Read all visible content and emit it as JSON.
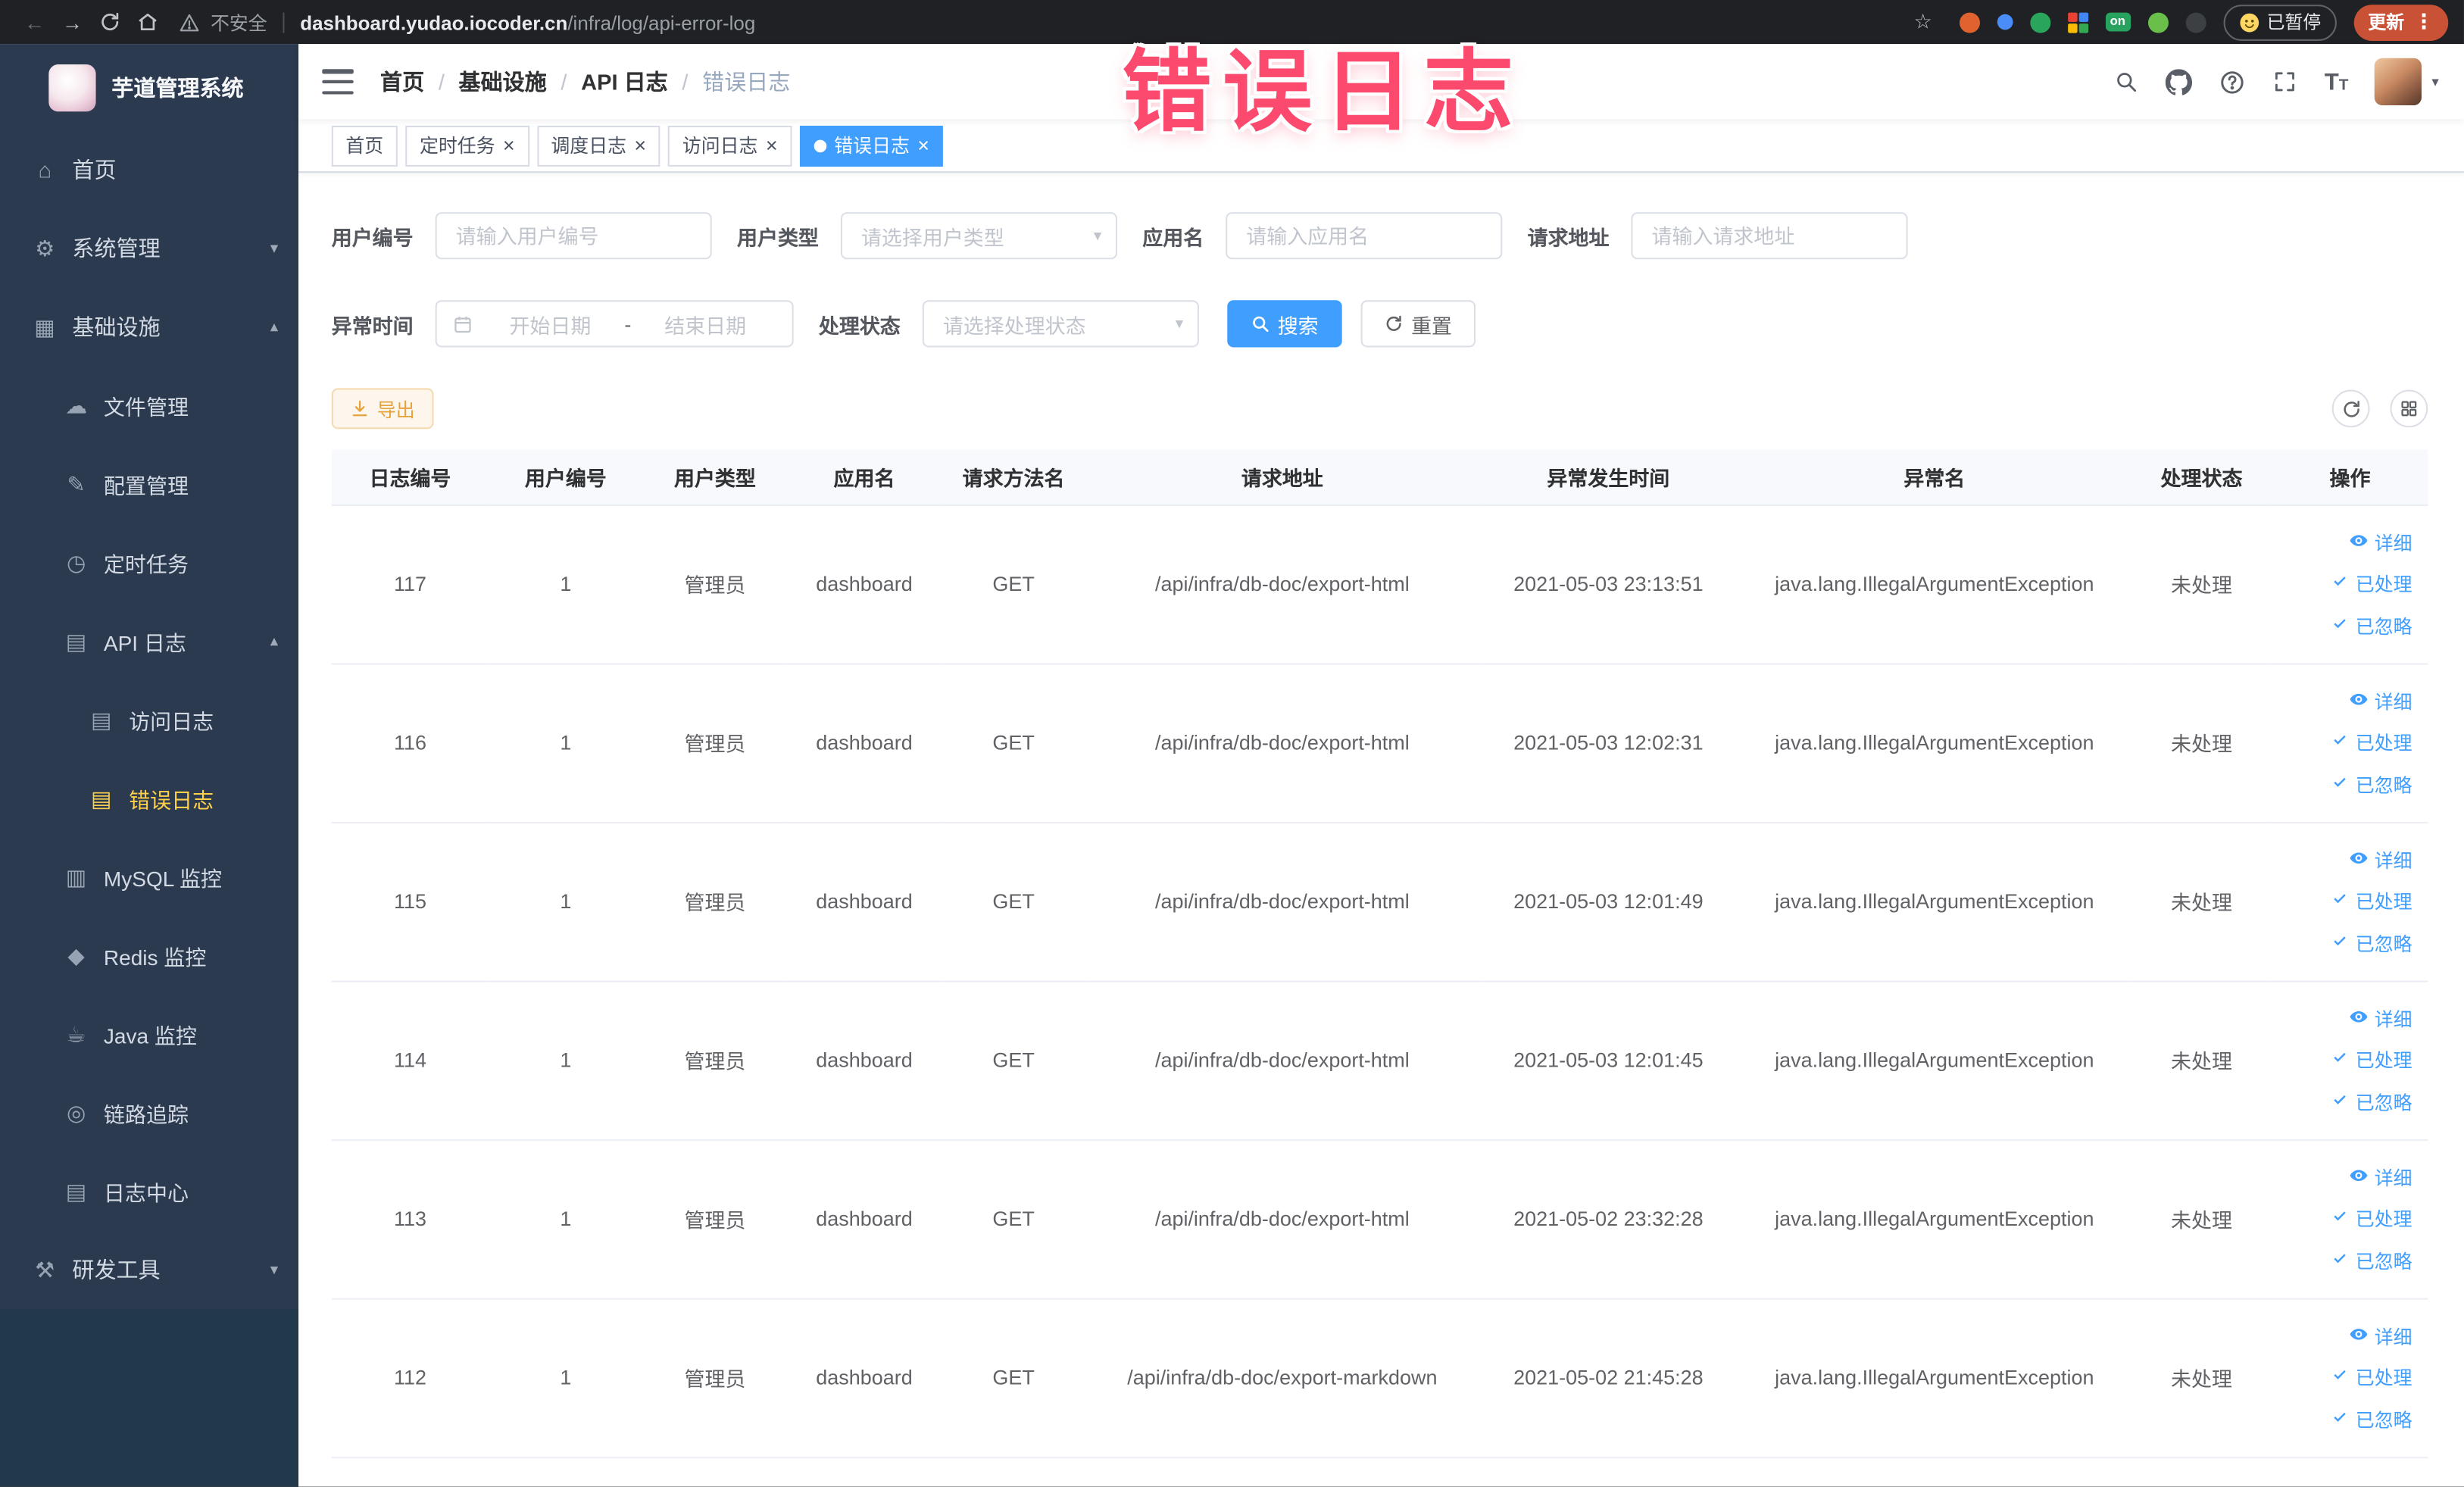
{
  "browser": {
    "security_label": "不安全",
    "url_domain": "dashboard.yudao.iocoder.cn",
    "url_path": "/infra/log/api-error-log",
    "on_badge": "on",
    "paused_button": "已暂停",
    "update_button": "更新"
  },
  "icons": {
    "back": "←",
    "forward": "→",
    "star": "☆",
    "kebab": "⋮",
    "caret_down": "▾",
    "select_arrow": "▾",
    "chevron_down": "▾",
    "chevron_up": "▴",
    "close": "×",
    "breadcrumb_separator": "/",
    "font_size_big": "T",
    "font_size_small": "T"
  },
  "annotation": {
    "text": "错误日志"
  },
  "sidebar": {
    "logo_title": "芋道管理系统",
    "items": [
      {
        "id": "home",
        "label": "首页",
        "level": 1,
        "icon": "home-icon",
        "glyph": "⌂",
        "chevron": null,
        "active": false
      },
      {
        "id": "system",
        "label": "系统管理",
        "level": 1,
        "icon": "gear-icon",
        "glyph": "⚙",
        "chevron": "down",
        "active": false
      },
      {
        "id": "infra",
        "label": "基础设施",
        "level": 1,
        "icon": "monitor-icon",
        "glyph": "▦",
        "chevron": "up",
        "active": false
      },
      {
        "id": "file",
        "label": "文件管理",
        "level": 2,
        "icon": "cloud-icon",
        "glyph": "☁",
        "chevron": null,
        "active": false
      },
      {
        "id": "config",
        "label": "配置管理",
        "level": 2,
        "icon": "edit-icon",
        "glyph": "✎",
        "chevron": null,
        "active": false
      },
      {
        "id": "job",
        "label": "定时任务",
        "level": 2,
        "icon": "timer-icon",
        "glyph": "◷",
        "chevron": null,
        "active": false
      },
      {
        "id": "api-log",
        "label": "API 日志",
        "level": 2,
        "icon": "document-icon",
        "glyph": "▤",
        "chevron": "up",
        "active": false
      },
      {
        "id": "access-log",
        "label": "访问日志",
        "level": 3,
        "icon": "document-icon",
        "glyph": "▤",
        "chevron": null,
        "active": false
      },
      {
        "id": "error-log",
        "label": "错误日志",
        "level": 3,
        "icon": "document-icon",
        "glyph": "▤",
        "chevron": null,
        "active": true
      },
      {
        "id": "mysql",
        "label": "MySQL 监控",
        "level": 2,
        "icon": "database-icon",
        "glyph": "▥",
        "chevron": null,
        "active": false
      },
      {
        "id": "redis",
        "label": "Redis 监控",
        "level": 2,
        "icon": "layers-icon",
        "glyph": "◆",
        "chevron": null,
        "active": false
      },
      {
        "id": "java",
        "label": "Java 监控",
        "level": 2,
        "icon": "coffee-icon",
        "glyph": "☕",
        "chevron": null,
        "active": false
      },
      {
        "id": "trace",
        "label": "链路追踪",
        "level": 2,
        "icon": "target-icon",
        "glyph": "◎",
        "chevron": null,
        "active": false
      },
      {
        "id": "log-center",
        "label": "日志中心",
        "level": 2,
        "icon": "logs-icon",
        "glyph": "▤",
        "chevron": null,
        "active": false
      },
      {
        "id": "devtools",
        "label": "研发工具",
        "level": 1,
        "icon": "toolbox-icon",
        "glyph": "⚒",
        "chevron": "down",
        "active": false
      }
    ]
  },
  "header": {
    "breadcrumb": [
      "首页",
      "基础设施",
      "API 日志",
      "错误日志"
    ]
  },
  "tabs": [
    {
      "label": "首页",
      "closable": false,
      "active": false
    },
    {
      "label": "定时任务",
      "closable": true,
      "active": false
    },
    {
      "label": "调度日志",
      "closable": true,
      "active": false
    },
    {
      "label": "访问日志",
      "closable": true,
      "active": false
    },
    {
      "label": "错误日志",
      "closable": true,
      "active": true
    }
  ],
  "filters": {
    "user_id": {
      "label": "用户编号",
      "placeholder": "请输入用户编号"
    },
    "user_type": {
      "label": "用户类型",
      "placeholder": "请选择用户类型"
    },
    "app_name": {
      "label": "应用名",
      "placeholder": "请输入应用名"
    },
    "request_url": {
      "label": "请求地址",
      "placeholder": "请输入请求地址"
    },
    "exception_time": {
      "label": "异常时间",
      "start_placeholder": "开始日期",
      "separator": "-",
      "end_placeholder": "结束日期"
    },
    "process_status": {
      "label": "处理状态",
      "placeholder": "请选择处理状态"
    },
    "search_button": "搜索",
    "reset_button": "重置"
  },
  "toolbar": {
    "export_button": "导出"
  },
  "table": {
    "columns": [
      "日志编号",
      "用户编号",
      "用户类型",
      "应用名",
      "请求方法名",
      "请求地址",
      "异常发生时间",
      "异常名",
      "处理状态",
      "操作"
    ],
    "actions": [
      {
        "name": "detail",
        "label": "详细",
        "icon": "eye-icon"
      },
      {
        "name": "processed",
        "label": "已处理",
        "icon": "check-icon"
      },
      {
        "name": "ignored",
        "label": "已忽略",
        "icon": "check-icon"
      }
    ],
    "rows": [
      {
        "id": "117",
        "user_id": "1",
        "user_type": "管理员",
        "app": "dashboard",
        "method": "GET",
        "url": "/api/infra/db-doc/export-html",
        "time": "2021-05-03 23:13:51",
        "exception": "java.lang.IllegalArgumentException",
        "status": "未处理"
      },
      {
        "id": "116",
        "user_id": "1",
        "user_type": "管理员",
        "app": "dashboard",
        "method": "GET",
        "url": "/api/infra/db-doc/export-html",
        "time": "2021-05-03 12:02:31",
        "exception": "java.lang.IllegalArgumentException",
        "status": "未处理"
      },
      {
        "id": "115",
        "user_id": "1",
        "user_type": "管理员",
        "app": "dashboard",
        "method": "GET",
        "url": "/api/infra/db-doc/export-html",
        "time": "2021-05-03 12:01:49",
        "exception": "java.lang.IllegalArgumentException",
        "status": "未处理"
      },
      {
        "id": "114",
        "user_id": "1",
        "user_type": "管理员",
        "app": "dashboard",
        "method": "GET",
        "url": "/api/infra/db-doc/export-html",
        "time": "2021-05-03 12:01:45",
        "exception": "java.lang.IllegalArgumentException",
        "status": "未处理"
      },
      {
        "id": "113",
        "user_id": "1",
        "user_type": "管理员",
        "app": "dashboard",
        "method": "GET",
        "url": "/api/infra/db-doc/export-html",
        "time": "2021-05-02 23:32:28",
        "exception": "java.lang.IllegalArgumentException",
        "status": "未处理"
      },
      {
        "id": "112",
        "user_id": "1",
        "user_type": "管理员",
        "app": "dashboard",
        "method": "GET",
        "url": "/api/infra/db-doc/export-markdown",
        "time": "2021-05-02 21:45:28",
        "exception": "java.lang.IllegalArgumentException",
        "status": "未处理"
      }
    ]
  }
}
